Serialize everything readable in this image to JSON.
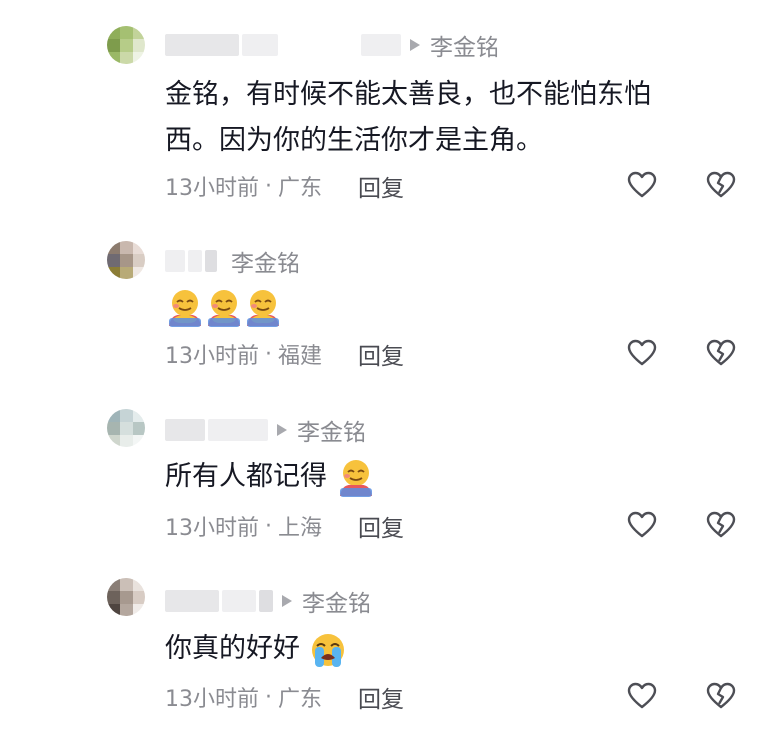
{
  "comments": [
    {
      "reply_to": "李金铭",
      "text_line1": "金铭，有时候不能太善良，也不能怕东怕",
      "text_line2": "西。因为你的生活你才是主角。",
      "time": "13小时前",
      "separator": "·",
      "location": "广东",
      "reply_label": "回复",
      "avatar_colors": [
        "#8fae5a",
        "#a5c072",
        "#c2d39a",
        "#7e9c4c",
        "#b6cc88",
        "#dfe7cc",
        "#9ab866",
        "#cbd9a8",
        "#eef3e4"
      ]
    },
    {
      "reply_to": "李金铭",
      "time": "13小时前",
      "separator": "·",
      "location": "福建",
      "reply_label": "回复",
      "emoji_count_label": "hugging-face-emoji",
      "avatar_colors": [
        "#8c7b6e",
        "#c9b8ae",
        "#e8dcd6",
        "#6f6a72",
        "#a79688",
        "#d9cdc4",
        "#8b7d36",
        "#b8aa77",
        "#efe8e3"
      ]
    },
    {
      "reply_to": "李金铭",
      "text": "所有人都记得",
      "time": "13小时前",
      "separator": "·",
      "location": "上海",
      "reply_label": "回复",
      "avatar_colors": [
        "#9fb4b8",
        "#c6d4d6",
        "#e4ecec",
        "#a7b5b0",
        "#d5dfdd",
        "#b8c7c4",
        "#cfd6cd",
        "#e8edea",
        "#f3f6f5"
      ]
    },
    {
      "reply_to": "李金铭",
      "text": "你真的好好",
      "time": "13小时前",
      "separator": "·",
      "location": "广东",
      "reply_label": "回复",
      "avatar_colors": [
        "#8a7e76",
        "#cbbfb7",
        "#e9e2dd",
        "#6d625b",
        "#a7998f",
        "#d8ccc4",
        "#4f4540",
        "#b4a79e",
        "#f0ebe8"
      ]
    }
  ],
  "colors": {
    "text_primary": "#161823",
    "text_secondary": "#8a8b91",
    "icon_gray": "#4d4e55"
  }
}
